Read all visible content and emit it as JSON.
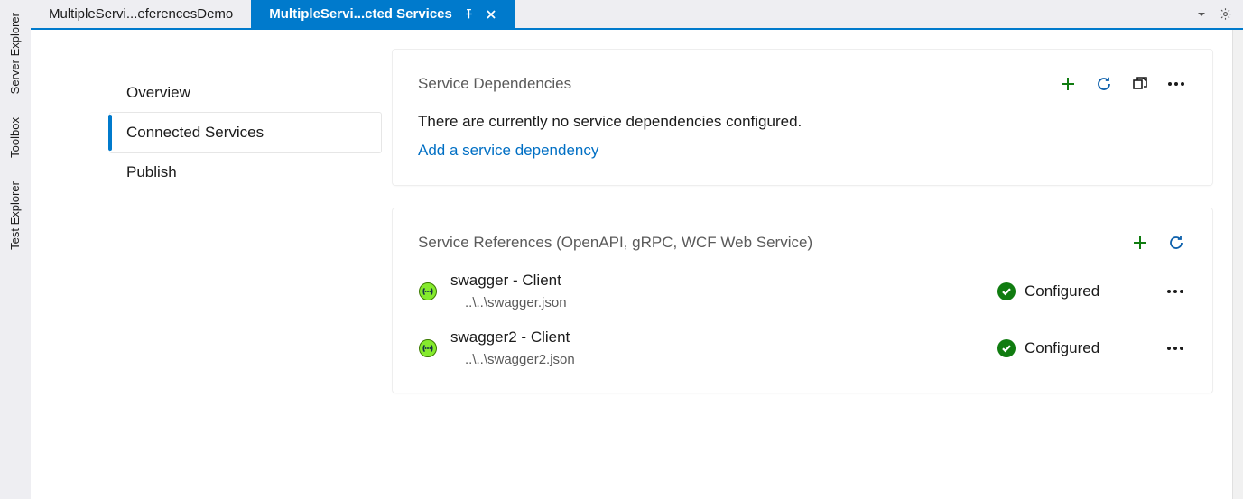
{
  "toolStrip": {
    "items": [
      {
        "label": "Server Explorer"
      },
      {
        "label": "Toolbox"
      },
      {
        "label": "Test Explorer"
      }
    ]
  },
  "tabs": {
    "inactive": {
      "label": "MultipleServi...eferencesDemo"
    },
    "active": {
      "label": "MultipleServi...cted Services"
    }
  },
  "sideNav": {
    "items": [
      "Overview",
      "Connected Services",
      "Publish"
    ],
    "selectedIndex": 1
  },
  "deps": {
    "title": "Service Dependencies",
    "emptyText": "There are currently no service dependencies configured.",
    "addLink": "Add a service dependency"
  },
  "refs": {
    "title": "Service References (OpenAPI, gRPC, WCF Web Service)",
    "items": [
      {
        "name": "swagger - Client",
        "path": "..\\..\\swagger.json",
        "status": "Configured"
      },
      {
        "name": "swagger2 - Client",
        "path": "..\\..\\swagger2.json",
        "status": "Configured"
      }
    ]
  },
  "colors": {
    "accent": "#007acc",
    "green": "#107c10"
  }
}
